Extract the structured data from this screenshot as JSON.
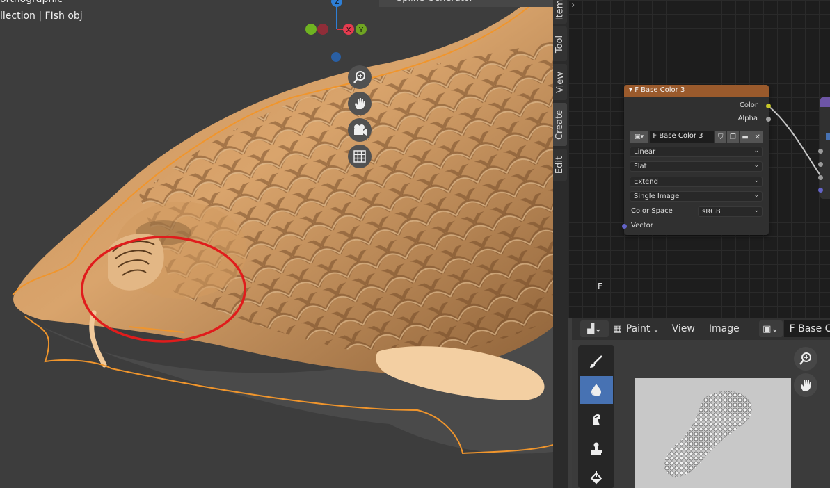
{
  "viewport": {
    "view_label": "orthographic",
    "collection_label": "llection | FIsh obj",
    "header_tab": "Spline Generator",
    "gizmo": {
      "z": "Z",
      "x": "X",
      "y": "Y"
    },
    "nav_icons": [
      "zoom-icon",
      "hand-pan-icon",
      "camera-icon",
      "grid-icon"
    ]
  },
  "side_tabs": [
    "Item",
    "Tool",
    "View",
    "Create",
    "Edit"
  ],
  "node_editor": {
    "node": {
      "title": "F Base Color 3",
      "outputs": [
        "Color",
        "Alpha"
      ],
      "image_name": "F Base Color 3",
      "interpolation": "Linear",
      "projection": "Flat",
      "extension": "Extend",
      "source": "Single Image",
      "color_space_label": "Color Space",
      "color_space_value": "sRGB",
      "input": "Vector"
    },
    "frame_label": "F"
  },
  "image_editor": {
    "mode": "Paint",
    "menus": [
      "View",
      "Image"
    ],
    "image_name": "F Base C"
  },
  "colors": {
    "fish": "#e9b986",
    "outline": "#f0952c",
    "circle": "#e01c1c",
    "node_header": "#9a5a2c",
    "active_tool": "#4772b3"
  }
}
